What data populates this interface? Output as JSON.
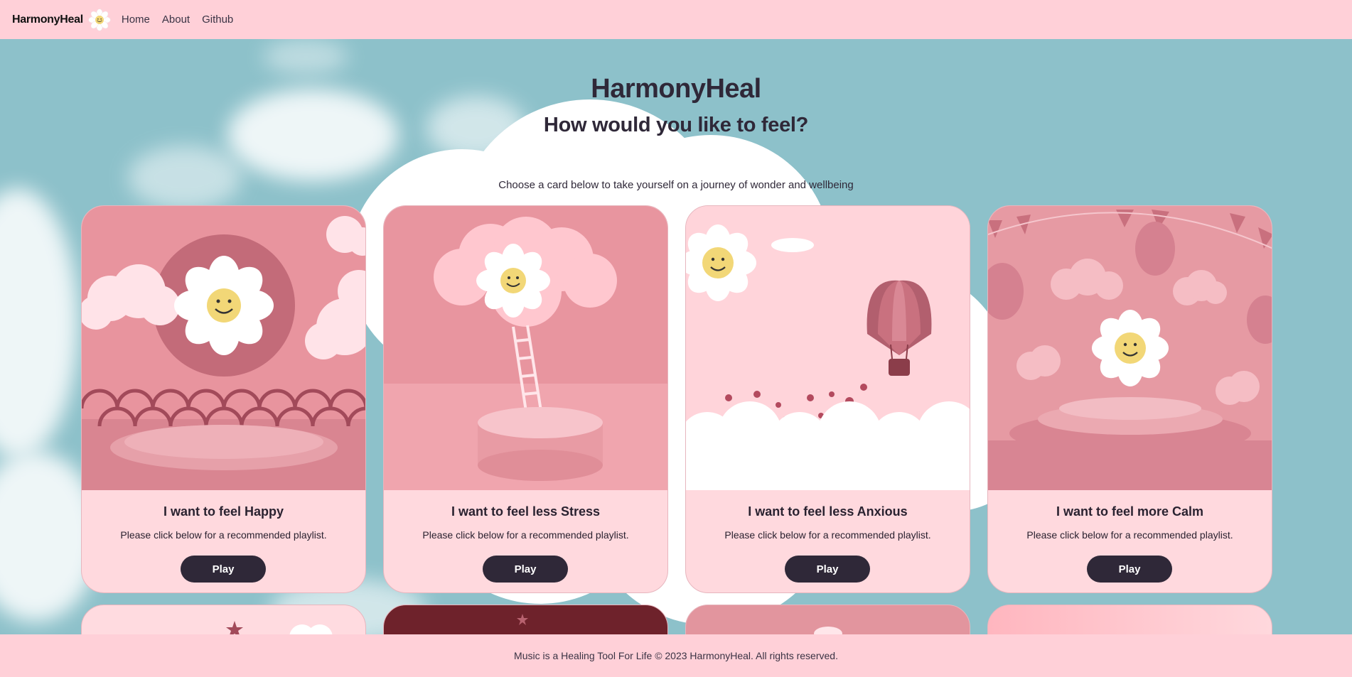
{
  "nav": {
    "brand": "HarmonyHeal",
    "links": [
      "Home",
      "About",
      "Github"
    ]
  },
  "hero": {
    "title": "HarmonyHeal",
    "subtitle": "How would you like to feel?",
    "description": "Choose a card below to take yourself on a journey of wonder and wellbeing"
  },
  "cards": [
    {
      "title": "I want to feel Happy",
      "text": "Please click below for a recommended playlist.",
      "button": "Play"
    },
    {
      "title": "I want to feel less Stress",
      "text": "Please click below for a recommended playlist.",
      "button": "Play"
    },
    {
      "title": "I want to feel less Anxious",
      "text": "Please click below for a recommended playlist.",
      "button": "Play"
    },
    {
      "title": "I want to feel more Calm",
      "text": "Please click below for a recommended playlist.",
      "button": "Play"
    }
  ],
  "footer": {
    "text": "Music is a Healing Tool For Life © 2023 HarmonyHeal. All rights reserved."
  },
  "colors": {
    "navbar_bg": "#ffd0d8",
    "sky": "#8dc1ca",
    "card_bg": "#ffd9de",
    "button_bg": "#2f2838",
    "text_dark": "#2f2838"
  }
}
